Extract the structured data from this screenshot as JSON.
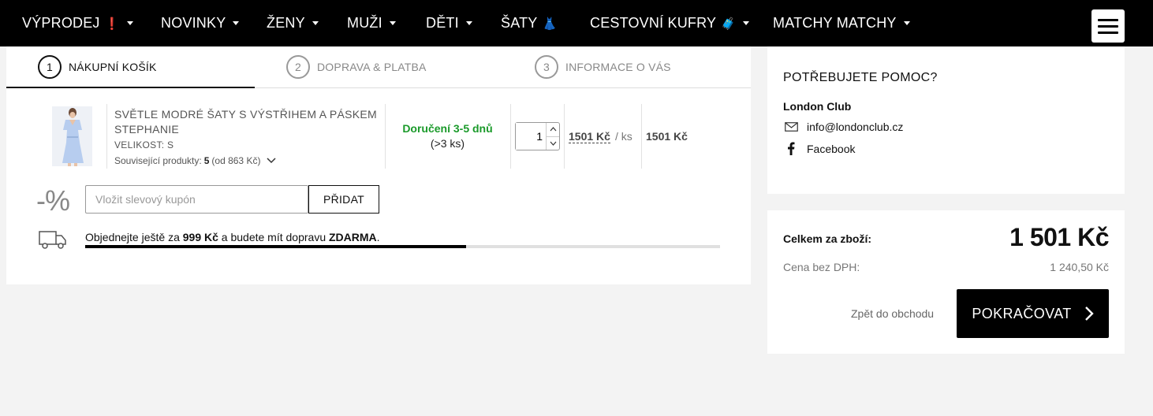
{
  "nav": {
    "items": [
      {
        "label": "VÝPRODEJ",
        "emoji": "❗",
        "has_caret": true
      },
      {
        "label": "NOVINKY",
        "emoji": "",
        "has_caret": true
      },
      {
        "label": "ŽENY",
        "emoji": "",
        "has_caret": true
      },
      {
        "label": "MUŽI",
        "emoji": "",
        "has_caret": true
      },
      {
        "label": "DĚTI",
        "emoji": "",
        "has_caret": true
      },
      {
        "label": "ŠATY",
        "emoji": "👗",
        "has_caret": false
      },
      {
        "label": "CESTOVNÍ KUFRY",
        "emoji": "🧳",
        "has_caret": true
      },
      {
        "label": "MATCHY MATCHY",
        "emoji": "",
        "has_caret": true
      }
    ],
    "menu_icon": "hamburger-icon"
  },
  "steps": [
    {
      "number": "1",
      "label": "NÁKUPNÍ KOŠÍK",
      "active": true
    },
    {
      "number": "2",
      "label": "DOPRAVA & PLATBA",
      "active": false
    },
    {
      "number": "3",
      "label": "INFORMACE O VÁS",
      "active": false
    }
  ],
  "cart": {
    "item": {
      "name": "SVĚTLE MODRÉ ŠATY S VÝSTŘIHEM A PÁSKEM STEPHANIE",
      "size": "VELIKOST: S",
      "related_prefix": "Související produkty:",
      "related_count": "5",
      "related_suffix": "(od 863 Kč)",
      "delivery_time": "Doručení 3-5 dnů",
      "stock": "(>3 ks)",
      "quantity": "1",
      "unit_price": "1501 Kč",
      "per_unit": "/ ks",
      "total_price": "1501 Kč"
    },
    "coupon": {
      "symbol": "-%",
      "placeholder": "Vložit slevový kupón",
      "button": "PŘIDAT"
    },
    "shipping": {
      "text_before": "Objednejte ještě za",
      "amount": "999 Kč",
      "text_middle": "a budete mít dopravu",
      "free": "ZDARMA",
      "text_end": ".",
      "progress": 0.6
    }
  },
  "help": {
    "title": "POTŘEBUJETE POMOC?",
    "company": "London Club",
    "email": "info@londonclub.cz",
    "facebook": "Facebook"
  },
  "summary": {
    "total_label": "Celkem za zboží:",
    "total": "1 501 Kč",
    "vat_label": "Cena bez DPH:",
    "vat": "1 240,50 Kč",
    "back": "Zpět do obchodu",
    "continue": "POKRAČOVAT"
  },
  "colors": {
    "accent": "#000000",
    "delivery_green": "#1a9a2a",
    "background": "#f3f3f3"
  }
}
